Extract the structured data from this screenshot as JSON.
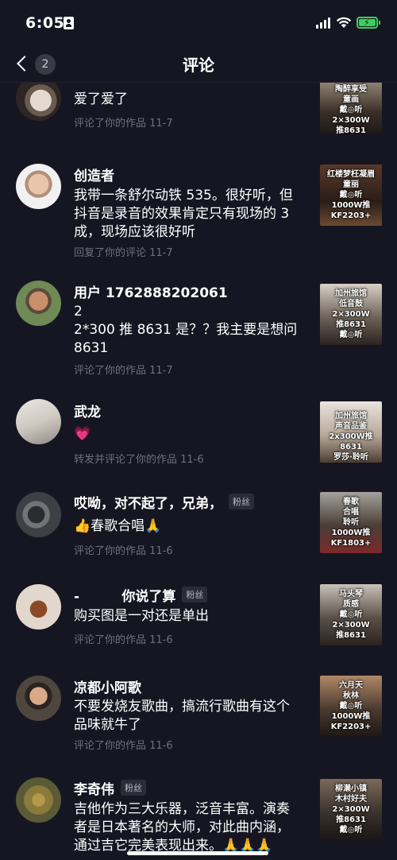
{
  "status": {
    "time": "6:05"
  },
  "nav": {
    "title": "评论",
    "back_count": "2"
  },
  "comments": [
    {
      "name": "",
      "badge": "",
      "text": "爱了爱了",
      "meta": "评论了你的作品  11-7",
      "thumb": "陶醉享受\n童画\n戴◎听\n2×300W\n推8631"
    },
    {
      "name": "创造者",
      "badge": "",
      "text": "我带一条舒尔动铁 535。很好听，但抖音是录音的效果肯定只有现场的 3 成，现场应该很好听",
      "meta": "回复了你的评论  11-7",
      "thumb": "红楼梦枉凝眉\n童丽\n戴◎听\n1000W推\nKF2203+"
    },
    {
      "name": "用户 1762888202061",
      "badge": "",
      "text": "2\n2*300 推 8631 是？？我主要是想问 8631",
      "meta": "评论了你的作品  11-7",
      "thumb": "加州旅馆\n低音鼓\n2×300W\n推8631\n戴◎听"
    },
    {
      "name": "武龙",
      "badge": "",
      "text": "💗",
      "meta": "转发并评论了你的作品  11-6",
      "thumb": "加州旅馆\n声音品鉴\n2x300W推8631\n罗莎·聆听"
    },
    {
      "name": "哎呦，对不起了，兄弟，",
      "badge": "粉丝",
      "text": "👍春歌合唱🙏",
      "meta": "评论了你的作品  11-6",
      "thumb": "春歌\n合唱\n聆听\n1000W推\nKF1803+"
    },
    {
      "name": "-         你说了算",
      "badge": "粉丝",
      "text": "购买图是一对还是单出",
      "meta": "评论了你的作品  11-6",
      "thumb": "马头琴\n质感\n戴◎听\n2×300W\n推8631"
    },
    {
      "name": "凉都小阿歌",
      "badge": "",
      "text": "不要发烧友歌曲，搞流行歌曲有这个品味就牛了",
      "meta": "评论了你的作品  11-6",
      "thumb": "六月天\n秋林\n戴◎听\n1000W推\nKF2203+"
    },
    {
      "name": "李奇伟",
      "badge": "粉丝",
      "text": "吉他作为三大乐器，泛音丰富。演奏者是日本著名的大师，对此曲内涵，通过吉它完美表现出来。🙏🙏🙏",
      "meta": "",
      "thumb": "柳濑小镇\n木村好夫\n2×300W\n推8631\n戴◎听"
    }
  ],
  "colors": {
    "background": "#161622",
    "meta_text": "#70707c",
    "battery": "#3ad15d"
  }
}
